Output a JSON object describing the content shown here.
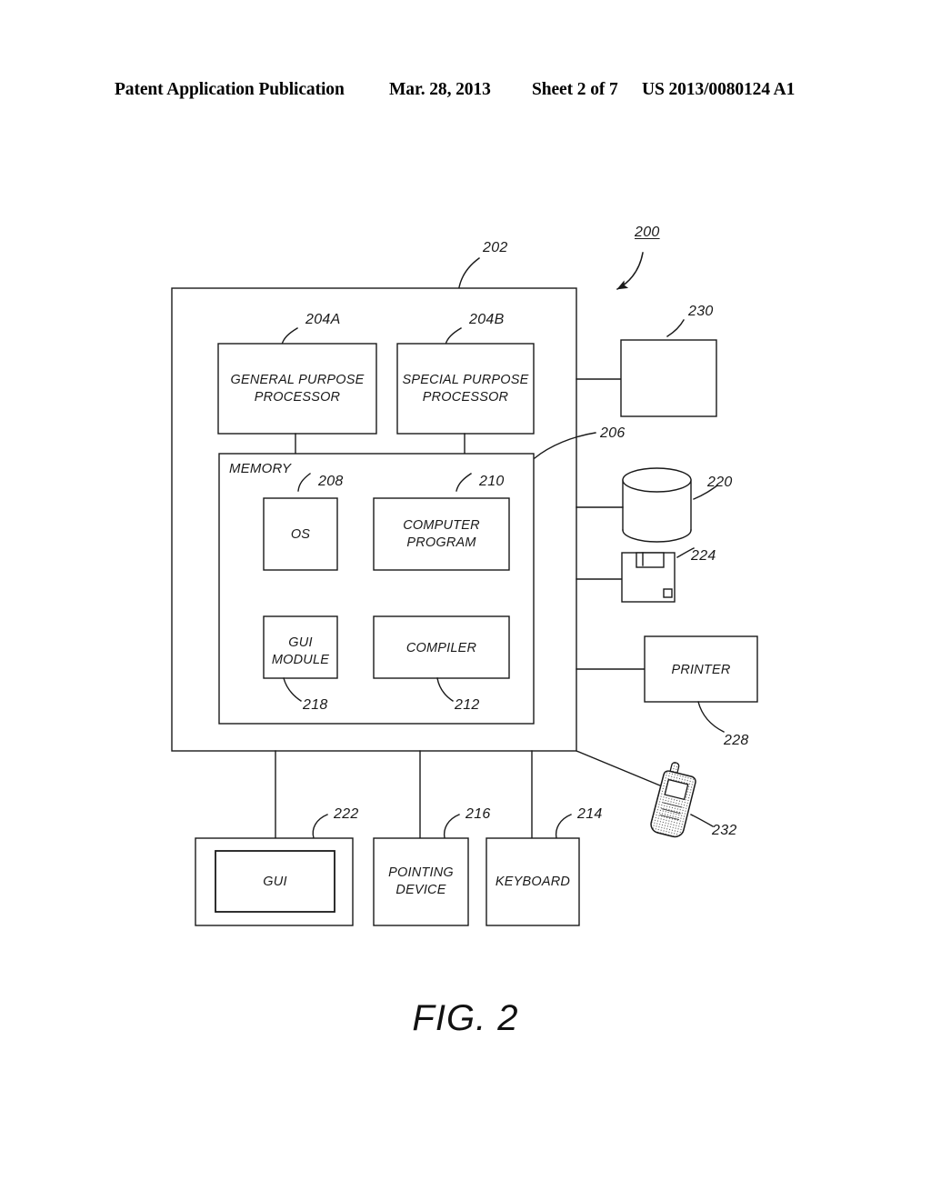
{
  "header": {
    "title": "Patent Application Publication",
    "date": "Mar. 28, 2013",
    "sheet": "Sheet 2 of 7",
    "publication_number": "US 2013/0080124 A1"
  },
  "figure": {
    "caption": "FIG. 2",
    "system_ref": "200",
    "computer_ref": "202",
    "bus_ref": "206"
  },
  "blocks": {
    "general_purpose_processor": {
      "label": "GENERAL PURPOSE\nPROCESSOR",
      "ref": "204A"
    },
    "special_purpose_processor": {
      "label": "SPECIAL PURPOSE\nPROCESSOR",
      "ref": "204B"
    },
    "memory": {
      "label": "MEMORY",
      "ref": "206"
    },
    "os": {
      "label": "OS",
      "ref": "208"
    },
    "computer_program": {
      "label": "COMPUTER\nPROGRAM",
      "ref": "210"
    },
    "gui_module": {
      "label": "GUI\nMODULE",
      "ref": "218"
    },
    "compiler": {
      "label": "COMPILER",
      "ref": "212"
    },
    "unlabeled_device": {
      "label": "",
      "ref": "230"
    },
    "data_storage": {
      "label": "",
      "ref": "220"
    },
    "removable_media": {
      "label": "",
      "ref": "224"
    },
    "printer": {
      "label": "PRINTER",
      "ref": "228"
    },
    "mobile_device": {
      "label": "",
      "ref": "232"
    },
    "gui": {
      "label": "GUI",
      "ref": "222"
    },
    "pointing_device": {
      "label": "POINTING\nDEVICE",
      "ref": "216"
    },
    "keyboard": {
      "label": "KEYBOARD",
      "ref": "214"
    }
  },
  "colors": {
    "ink": "#1a1a1a",
    "paper": "#ffffff"
  }
}
